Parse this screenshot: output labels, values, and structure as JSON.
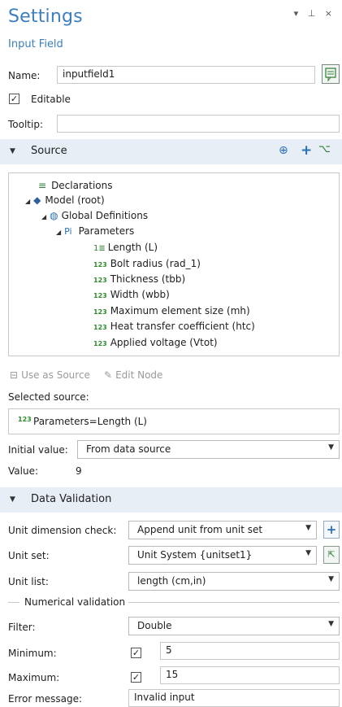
{
  "header": {
    "title": "Settings",
    "subtitle": "Input Field",
    "window_controls": "▾ ⊥ ×"
  },
  "name": {
    "label": "Name:",
    "value": "inputfield1"
  },
  "editable": {
    "label": "Editable",
    "checked": true
  },
  "tooltip": {
    "label": "Tooltip:",
    "value": ""
  },
  "source_section": {
    "title": "Source",
    "tree": [
      {
        "icon": "≡",
        "label": "Declarations"
      },
      {
        "icon": "◆",
        "label": "Model (root)"
      },
      {
        "icon": "◍",
        "label": "Global Definitions"
      },
      {
        "icon": "Pi",
        "label": "Parameters"
      },
      {
        "icon": "1:",
        "label": "Length (L)"
      },
      {
        "icon": "123",
        "label": "Bolt radius (rad_1)"
      },
      {
        "icon": "123",
        "label": "Thickness (tbb)"
      },
      {
        "icon": "123",
        "label": "Width (wbb)"
      },
      {
        "icon": "123",
        "label": "Maximum element size (mh)"
      },
      {
        "icon": "123",
        "label": "Heat transfer coefficient (htc)"
      },
      {
        "icon": "123",
        "label": "Applied voltage (Vtot)"
      }
    ],
    "use_as_source": "Use as Source",
    "edit_node": "Edit Node",
    "selected_source_label": "Selected source:",
    "selected_source_icon": "123",
    "selected_source_value": "Parameters=Length (L)",
    "initial_value_label": "Initial value:",
    "initial_value": "From data source",
    "value_label": "Value:",
    "value": "9"
  },
  "validation_section": {
    "title": "Data Validation",
    "unit_dimension_label": "Unit dimension check:",
    "unit_dimension_value": "Append unit from unit set",
    "unit_set_label": "Unit set:",
    "unit_set_value": "Unit System {unitset1}",
    "unit_list_label": "Unit list:",
    "unit_list_value": "length (cm,in)",
    "numerical_validation_label": "Numerical validation",
    "filter_label": "Filter:",
    "filter_value": "Double",
    "minimum_label": "Minimum:",
    "minimum_checked": true,
    "minimum_value": "5",
    "maximum_label": "Maximum:",
    "maximum_checked": true,
    "maximum_value": "15",
    "error_message_label": "Error message:",
    "error_message_value": "Invalid input"
  }
}
